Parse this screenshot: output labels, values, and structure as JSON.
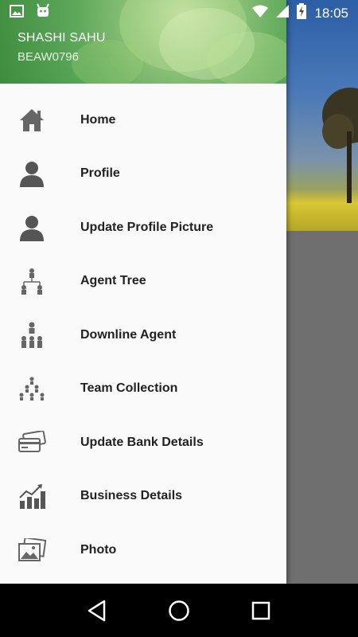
{
  "status_bar": {
    "time": "18:05",
    "icons": [
      "image-icon",
      "android-icon",
      "wifi-icon",
      "signal-icon",
      "battery-charging-icon"
    ]
  },
  "drawer": {
    "user_name": "SHASHI SAHU",
    "user_id": "BEAW0796",
    "items": [
      {
        "label": "Home",
        "icon": "home-icon"
      },
      {
        "label": "Profile",
        "icon": "person-icon"
      },
      {
        "label": "Update Profile Picture",
        "icon": "person-icon"
      },
      {
        "label": "Agent Tree",
        "icon": "org-tree-icon"
      },
      {
        "label": "Downline Agent",
        "icon": "downline-icon"
      },
      {
        "label": "Team Collection",
        "icon": "team-pyramid-icon"
      },
      {
        "label": "Update Bank Details",
        "icon": "bank-cards-icon"
      },
      {
        "label": "Business Details",
        "icon": "bar-chart-icon"
      },
      {
        "label": "Photo",
        "icon": "photo-icon"
      }
    ]
  },
  "nav_bar": {
    "buttons": [
      "back-icon",
      "home-circle-icon",
      "recents-icon"
    ]
  },
  "colors": {
    "drawer_bg": "#fafafa",
    "header_green": "#5da85a",
    "icon_gray": "#555555",
    "scrim": "#6f6f6f"
  }
}
